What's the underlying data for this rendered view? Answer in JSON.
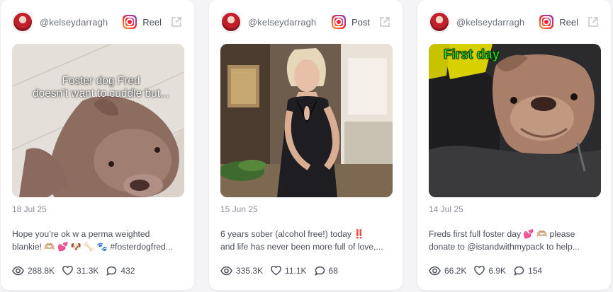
{
  "cards": [
    {
      "handle": "@kelseydarragh",
      "post_type": "Reel",
      "overlay_text": "Foster dog Fred\ndoesn’t want to cuddle but...",
      "date": "18 Jul 25",
      "caption_line1": "Hope you’re ok w a perma weighted",
      "caption_line2": "blankie! 🫶🏼 💕 🐶 🦴 🐾 #fosterdogfred...",
      "views": "288.8K",
      "likes": "31.3K",
      "comments": "432"
    },
    {
      "handle": "@kelseydarragh",
      "post_type": "Post",
      "date": "15 Jun 25",
      "caption_line1": "6 years sober (alcohol free!) today ‼️",
      "caption_line2": "and life has never been more full of love,...",
      "views": "335.3K",
      "likes": "11.1K",
      "comments": "68"
    },
    {
      "handle": "@kelseydarragh",
      "post_type": "Reel",
      "overlay_text": "First day",
      "date": "14 Jul 25",
      "caption_line1": "Freds first full foster day 💕 🫶🏼 please",
      "caption_line2": "donate to @istandwithmypack to help...",
      "views": "66.2K",
      "likes": "6.9K",
      "comments": "154"
    }
  ],
  "icons": {
    "platform": "instagram-icon",
    "open": "external-link-icon",
    "views": "eye-icon",
    "likes": "heart-icon",
    "comments": "comment-icon"
  }
}
